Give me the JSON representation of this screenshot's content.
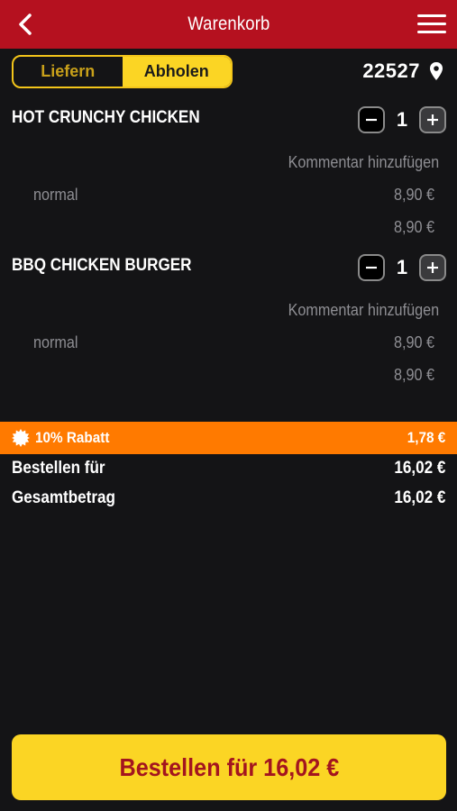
{
  "header": {
    "title": "Warenkorb",
    "back_icon": "chevron-left-icon",
    "menu_icon": "hamburger-menu-icon"
  },
  "delivery_mode": {
    "options": [
      "Liefern",
      "Abholen"
    ],
    "selected": "Abholen"
  },
  "location": {
    "zip": "22527",
    "icon": "location-pin-icon"
  },
  "cart": {
    "items": [
      {
        "name": "HOT CRUNCHY CHICKEN",
        "quantity": "1",
        "comment_label": "Kommentar hinzufügen",
        "variant": "normal",
        "variant_price": "8,90 €",
        "total_price": "8,90 €"
      },
      {
        "name": "BBQ CHICKEN BURGER",
        "quantity": "1",
        "comment_label": "Kommentar hinzufügen",
        "variant": "normal",
        "variant_price": "8,90 €",
        "total_price": "8,90 €"
      }
    ]
  },
  "discount": {
    "label": "10% Rabatt",
    "value": "1,78 €",
    "icon": "badge-burst-icon"
  },
  "summary": {
    "order_for_label": "Bestellen für",
    "order_for_value": "16,02 €",
    "total_label": "Gesamtbetrag",
    "total_value": "16,02 €"
  },
  "order_button": {
    "label": "Bestellen für 16,02 €"
  },
  "colors": {
    "header_red": "#b5111f",
    "accent_yellow": "#fbd524",
    "discount_orange": "#ff7a00",
    "background": "#141416",
    "button_text_red": "#a3151f"
  }
}
